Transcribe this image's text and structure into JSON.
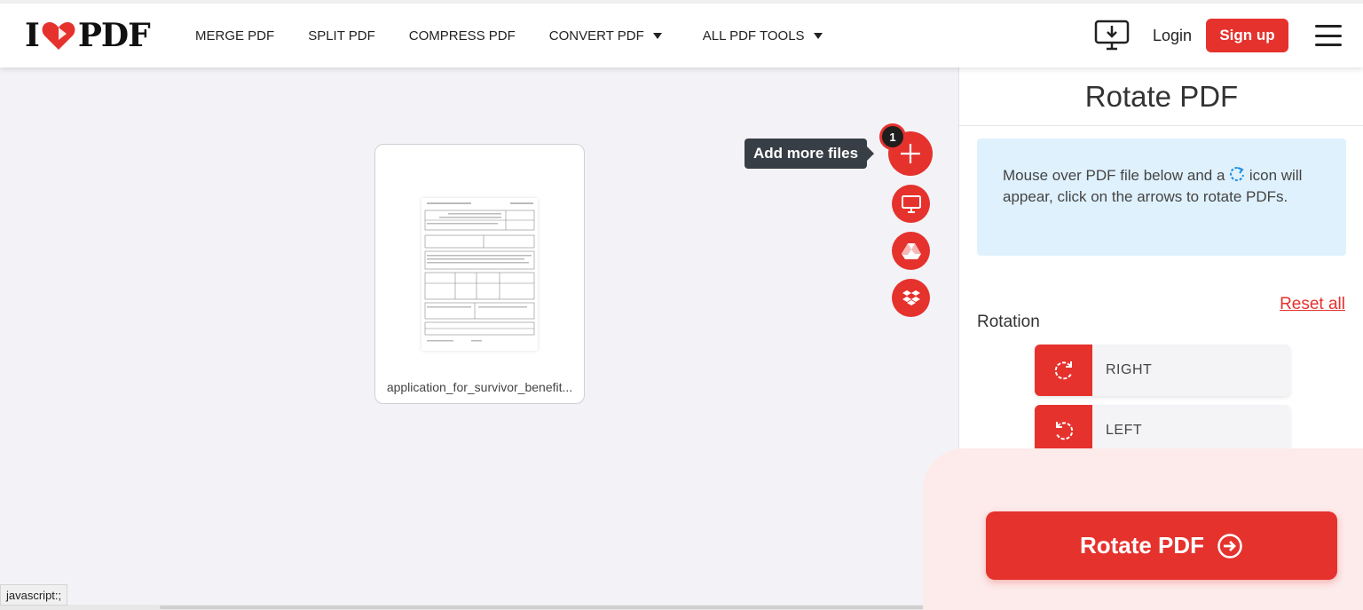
{
  "header": {
    "logo_left": "I",
    "logo_right": "PDF",
    "nav": [
      {
        "label": "MERGE PDF"
      },
      {
        "label": "SPLIT PDF"
      },
      {
        "label": "COMPRESS PDF"
      },
      {
        "label": "CONVERT PDF"
      },
      {
        "label": "ALL PDF TOOLS"
      }
    ],
    "login": "Login",
    "signup": "Sign up"
  },
  "workspace": {
    "file_name": "application_for_survivor_benefit...",
    "add_tooltip": "Add more files",
    "file_count": "1"
  },
  "panel": {
    "title": "Rotate PDF",
    "info_before": "Mouse over PDF file below and a",
    "info_after": "icon will appear, click on the arrows to rotate PDFs.",
    "reset": "Reset all",
    "rotation_label": "Rotation",
    "right": "RIGHT",
    "left": "LEFT",
    "action": "Rotate PDF"
  },
  "status_bar": "javascript:;",
  "colors": {
    "brand_red": "#e5322d",
    "info_bg": "#dff1fd",
    "page_bg": "#f3f3f7"
  },
  "icons": [
    "heart-logo-icon",
    "caret-down-icon",
    "desktop-download-icon",
    "hamburger-icon",
    "plus-icon",
    "computer-icon",
    "google-drive-icon",
    "dropbox-icon",
    "rotate-icon",
    "rotate-right-icon",
    "rotate-left-icon",
    "arrow-right-circle-icon"
  ]
}
